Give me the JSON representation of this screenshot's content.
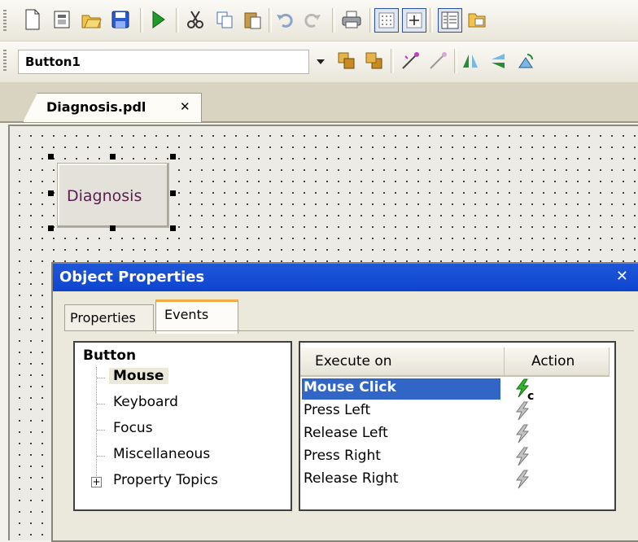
{
  "toolbar": {
    "icons": [
      "new-document",
      "new-form",
      "open-folder",
      "save",
      "run",
      "cut",
      "copy",
      "paste",
      "undo",
      "redo",
      "print",
      "grid",
      "snap-to-grid",
      "properties-panel",
      "library"
    ]
  },
  "object_selector": {
    "value": "Button1"
  },
  "document_tab": {
    "label": "Diagnosis.pdl",
    "close": "✕"
  },
  "canvas": {
    "button_text": "Diagnosis"
  },
  "dialog": {
    "title": "Object Properties",
    "close": "✕",
    "tabs": [
      {
        "label": "Properties"
      },
      {
        "label": "Events"
      }
    ],
    "active_tab": "Events",
    "tree": {
      "root": "Button",
      "items": [
        {
          "label": "Mouse",
          "selected": true
        },
        {
          "label": "Keyboard"
        },
        {
          "label": "Focus"
        },
        {
          "label": "Miscellaneous"
        },
        {
          "label": "Property Topics",
          "expander": "+"
        }
      ]
    },
    "events": {
      "columns": [
        "Execute on",
        "Action"
      ],
      "rows": [
        {
          "label": "Mouse Click",
          "selected": true,
          "action_marker": "c"
        },
        {
          "label": "Press Left"
        },
        {
          "label": "Release Left"
        },
        {
          "label": "Press Right"
        },
        {
          "label": "Release Right"
        }
      ]
    }
  },
  "colors": {
    "title_bar": "#0d45d0",
    "selection": "#3266c6",
    "active_bolt": "#2fb82c",
    "tab_accent": "#f0ad46"
  }
}
